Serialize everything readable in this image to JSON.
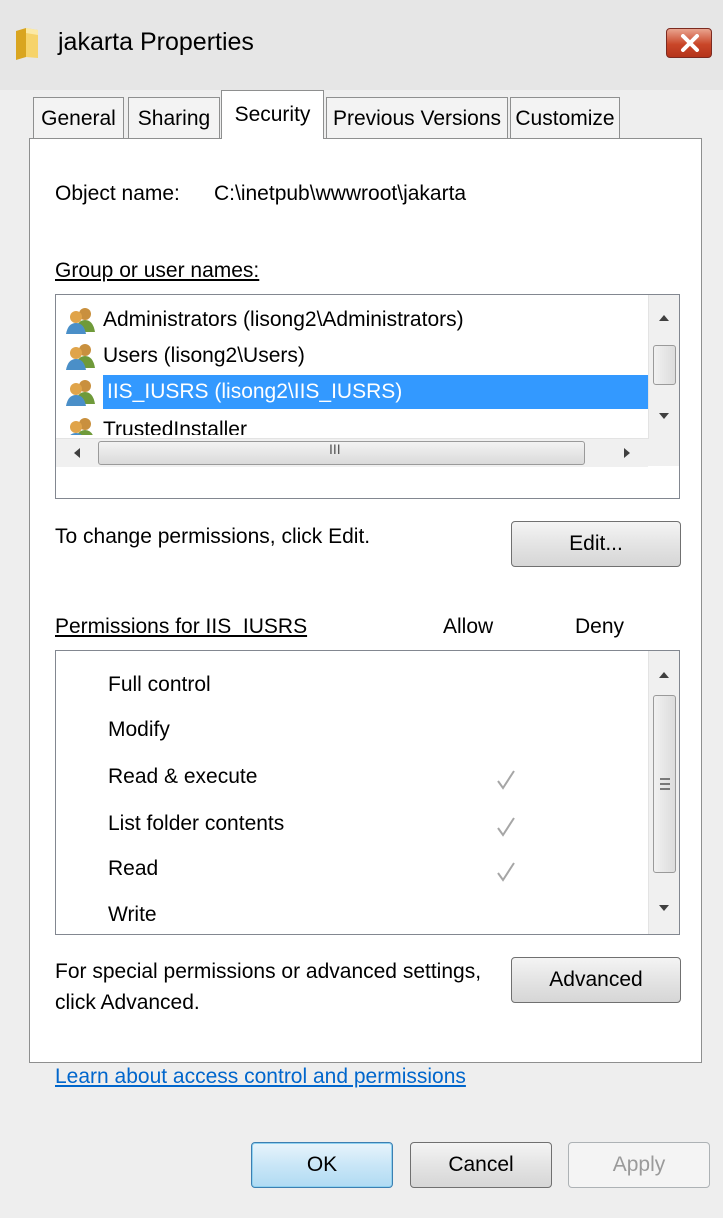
{
  "window": {
    "title": "jakarta Properties"
  },
  "tabs": [
    {
      "label": "General"
    },
    {
      "label": "Sharing"
    },
    {
      "label": "Security"
    },
    {
      "label": "Previous Versions"
    },
    {
      "label": "Customize"
    }
  ],
  "active_tab": "Security",
  "object": {
    "label": "Object name:",
    "value": "C:\\inetpub\\wwwroot\\jakarta"
  },
  "groups": {
    "label": "Group or user names:",
    "items": [
      {
        "label": "Administrators (lisong2\\Administrators)"
      },
      {
        "label": "Users (lisong2\\Users)"
      },
      {
        "label": "IIS_IUSRS (lisong2\\IIS_IUSRS)",
        "selected": true
      },
      {
        "label": "TrustedInstaller"
      }
    ],
    "hscroll_grip": "III"
  },
  "change": {
    "text": "To change permissions, click Edit.",
    "edit_label": "Edit..."
  },
  "permissions": {
    "header": "Permissions for IIS_IUSRS",
    "allow_label": "Allow",
    "deny_label": "Deny",
    "items": [
      {
        "label": "Full control",
        "allow": false,
        "deny": false
      },
      {
        "label": "Modify",
        "allow": false,
        "deny": false
      },
      {
        "label": "Read & execute",
        "allow": true,
        "deny": false
      },
      {
        "label": "List folder contents",
        "allow": true,
        "deny": false
      },
      {
        "label": "Read",
        "allow": true,
        "deny": false
      },
      {
        "label": "Write",
        "allow": false,
        "deny": false
      }
    ]
  },
  "advanced": {
    "text_line1": "For special permissions or advanced settings,",
    "text_line2": "click Advanced.",
    "button_label": "Advanced"
  },
  "link_text": "Learn about access control and permissions",
  "buttons": {
    "ok": "OK",
    "cancel": "Cancel",
    "apply": "Apply"
  },
  "colors": {
    "selection": "#3399ff",
    "link": "#0066cc",
    "check": "#a6a6a6"
  }
}
